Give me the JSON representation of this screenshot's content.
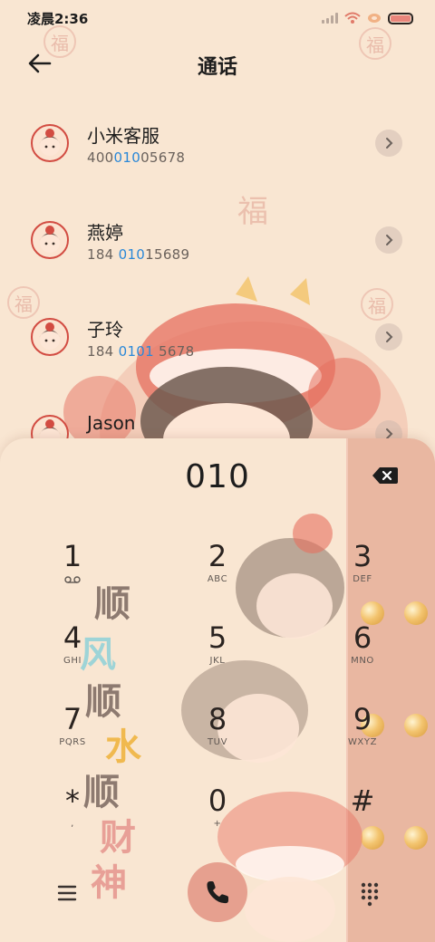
{
  "status_bar": {
    "time": "凌晨2:36"
  },
  "header": {
    "title": "通话"
  },
  "contacts": [
    {
      "name": "小米客服",
      "number_pre": "400",
      "number_hl": "010",
      "number_post": "05678"
    },
    {
      "name": "燕婷",
      "number_pre": "184 ",
      "number_hl": "010",
      "number_post": "15689"
    },
    {
      "name": "子玲",
      "number_pre": "184 ",
      "number_hl": "0101",
      "number_post": " 5678"
    },
    {
      "name": "Jason",
      "number_pre": "",
      "number_hl": "",
      "number_post": ""
    }
  ],
  "dialer": {
    "input": "010",
    "keys": [
      {
        "digit": "1",
        "letters": ""
      },
      {
        "digit": "2",
        "letters": "ABC"
      },
      {
        "digit": "3",
        "letters": "DEF"
      },
      {
        "digit": "4",
        "letters": "GHI"
      },
      {
        "digit": "5",
        "letters": "JKL"
      },
      {
        "digit": "6",
        "letters": "MNO"
      },
      {
        "digit": "7",
        "letters": "PQRS"
      },
      {
        "digit": "8",
        "letters": "TUV"
      },
      {
        "digit": "9",
        "letters": "WXYZ"
      },
      {
        "digit": "*",
        "letters": ","
      },
      {
        "digit": "0",
        "letters": "+"
      },
      {
        "digit": "#",
        "letters": ""
      }
    ]
  },
  "decor": {
    "fu": "福",
    "calligraphy": [
      "顺",
      "风",
      "顺",
      "水",
      "顺",
      "财",
      "神"
    ]
  },
  "colors": {
    "background": "#f9e6d2",
    "accent": "#e6a08f",
    "highlight": "#2a88d8",
    "side_strip": "#e9b7a1"
  },
  "icons": {
    "back": "back-arrow-icon",
    "chevron": "chevron-right-icon",
    "backspace": "backspace-icon",
    "voicemail": "voicemail-icon",
    "menu": "menu-icon",
    "call": "phone-icon",
    "keypad": "keypad-icon"
  }
}
